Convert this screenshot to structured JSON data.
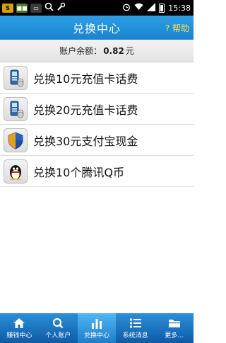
{
  "status_bar": {
    "time": "15:38",
    "left_icons": [
      "app-notification-icon",
      "bbm-icon",
      "chat-icon",
      "search-icon",
      "wrench-icon"
    ],
    "right_icons": [
      "alarm-icon",
      "wifi-icon",
      "signal-icon",
      "battery-icon"
    ]
  },
  "header": {
    "title": "兑换中心",
    "help_label": "? 帮助"
  },
  "balance": {
    "label": "账户余额：",
    "value": "0.82",
    "unit": "元"
  },
  "items": [
    {
      "label": "兑换10元充值卡话费",
      "icon": "phone-card-icon"
    },
    {
      "label": "兑换20元充值卡话费",
      "icon": "phone-card-icon"
    },
    {
      "label": "兑换30元支付宝现金",
      "icon": "alipay-shield-icon"
    },
    {
      "label": "兑换10个腾讯Q币",
      "icon": "qq-penguin-icon"
    }
  ],
  "tabs": [
    {
      "label": "赚钱中心",
      "icon": "home-icon",
      "active": false
    },
    {
      "label": "个人账户",
      "icon": "search-icon",
      "active": false
    },
    {
      "label": "兑换中心",
      "icon": "bar-chart-icon",
      "active": true
    },
    {
      "label": "系统消息",
      "icon": "list-icon",
      "active": false
    },
    {
      "label": "更多...",
      "icon": "folder-icon",
      "active": false
    }
  ],
  "colors": {
    "header": "#1a82cf",
    "help_text": "#ffe14a",
    "tab_bar": "#0f5aa5",
    "tab_active": "#4fb7f5"
  }
}
